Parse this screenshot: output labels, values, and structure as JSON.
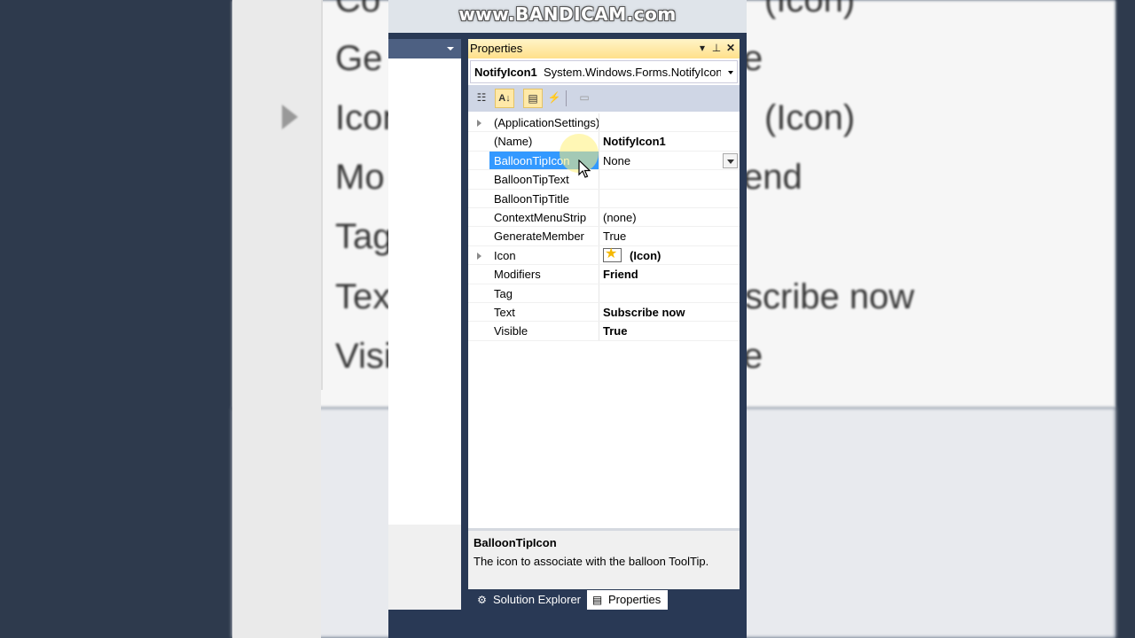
{
  "watermark": "www.BANDICAM.com",
  "background_mirror": {
    "texts": [
      "Co",
      "(Icon)",
      "Ge",
      "e",
      "Icon",
      "(Icon)",
      "Mo",
      "end",
      "Tag",
      "Tex",
      "scribe now",
      "Visi",
      "e"
    ]
  },
  "properties_window": {
    "title": "Properties",
    "pin_icon": "pin-icon",
    "close_icon": "close-icon",
    "object_selector": {
      "name": "NotifyIcon1",
      "type": "System.Windows.Forms.NotifyIcon"
    },
    "toolbar": [
      {
        "icon": "categorized-icon",
        "label": "Categorized"
      },
      {
        "icon": "alphabetical-icon",
        "label": "Alphabetical",
        "active": true
      },
      {
        "icon": "properties-icon",
        "label": "Properties",
        "active": true
      },
      {
        "icon": "events-icon",
        "label": "Events"
      },
      {
        "icon": "property-pages-icon",
        "label": "Property Pages"
      }
    ],
    "rows": [
      {
        "name": "(ApplicationSettings)",
        "value": "",
        "expandable": true
      },
      {
        "name": "(Name)",
        "value": "NotifyIcon1",
        "bold": true
      },
      {
        "name": "BalloonTipIcon",
        "value": "None",
        "selected": true,
        "dropdown": true
      },
      {
        "name": "BalloonTipText",
        "value": ""
      },
      {
        "name": "BalloonTipTitle",
        "value": ""
      },
      {
        "name": "ContextMenuStrip",
        "value": "(none)"
      },
      {
        "name": "GenerateMember",
        "value": "True"
      },
      {
        "name": "Icon",
        "value": "(Icon)",
        "bold": true,
        "expandable": true,
        "icon": "star-icon"
      },
      {
        "name": "Modifiers",
        "value": "Friend",
        "bold": true
      },
      {
        "name": "Tag",
        "value": ""
      },
      {
        "name": "Text",
        "value": "Subscribe now",
        "bold": true
      },
      {
        "name": "Visible",
        "value": "True",
        "bold": true
      }
    ],
    "description": {
      "title": "BalloonTipIcon",
      "text": "The icon to associate with the balloon ToolTip."
    }
  },
  "bottom_tabs": [
    {
      "label": "Solution Explorer",
      "icon": "solution-explorer-icon",
      "active": false
    },
    {
      "label": "Properties",
      "icon": "properties-tab-icon",
      "active": true
    }
  ]
}
